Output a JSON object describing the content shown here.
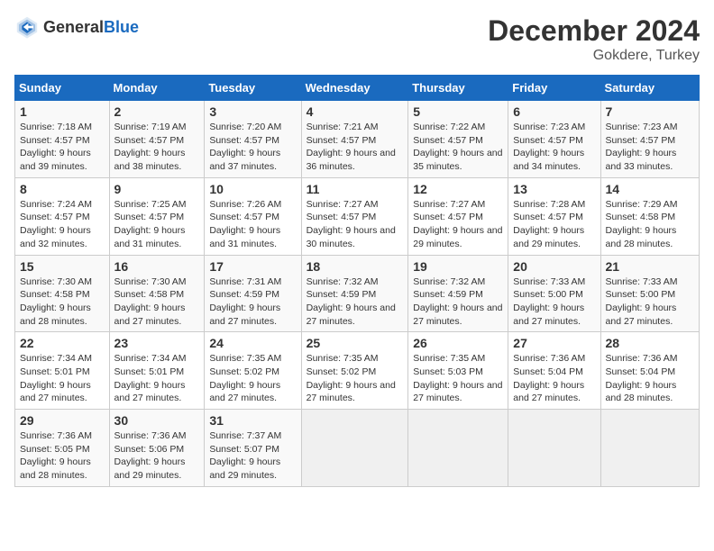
{
  "header": {
    "logo_general": "General",
    "logo_blue": "Blue",
    "title": "December 2024",
    "subtitle": "Gokdere, Turkey"
  },
  "calendar": {
    "days_of_week": [
      "Sunday",
      "Monday",
      "Tuesday",
      "Wednesday",
      "Thursday",
      "Friday",
      "Saturday"
    ],
    "weeks": [
      [
        {
          "day": "1",
          "sunrise": "7:18 AM",
          "sunset": "4:57 PM",
          "daylight": "9 hours and 39 minutes."
        },
        {
          "day": "2",
          "sunrise": "7:19 AM",
          "sunset": "4:57 PM",
          "daylight": "9 hours and 38 minutes."
        },
        {
          "day": "3",
          "sunrise": "7:20 AM",
          "sunset": "4:57 PM",
          "daylight": "9 hours and 37 minutes."
        },
        {
          "day": "4",
          "sunrise": "7:21 AM",
          "sunset": "4:57 PM",
          "daylight": "9 hours and 36 minutes."
        },
        {
          "day": "5",
          "sunrise": "7:22 AM",
          "sunset": "4:57 PM",
          "daylight": "9 hours and 35 minutes."
        },
        {
          "day": "6",
          "sunrise": "7:23 AM",
          "sunset": "4:57 PM",
          "daylight": "9 hours and 34 minutes."
        },
        {
          "day": "7",
          "sunrise": "7:23 AM",
          "sunset": "4:57 PM",
          "daylight": "9 hours and 33 minutes."
        }
      ],
      [
        {
          "day": "8",
          "sunrise": "7:24 AM",
          "sunset": "4:57 PM",
          "daylight": "9 hours and 32 minutes."
        },
        {
          "day": "9",
          "sunrise": "7:25 AM",
          "sunset": "4:57 PM",
          "daylight": "9 hours and 31 minutes."
        },
        {
          "day": "10",
          "sunrise": "7:26 AM",
          "sunset": "4:57 PM",
          "daylight": "9 hours and 31 minutes."
        },
        {
          "day": "11",
          "sunrise": "7:27 AM",
          "sunset": "4:57 PM",
          "daylight": "9 hours and 30 minutes."
        },
        {
          "day": "12",
          "sunrise": "7:27 AM",
          "sunset": "4:57 PM",
          "daylight": "9 hours and 29 minutes."
        },
        {
          "day": "13",
          "sunrise": "7:28 AM",
          "sunset": "4:57 PM",
          "daylight": "9 hours and 29 minutes."
        },
        {
          "day": "14",
          "sunrise": "7:29 AM",
          "sunset": "4:58 PM",
          "daylight": "9 hours and 28 minutes."
        }
      ],
      [
        {
          "day": "15",
          "sunrise": "7:30 AM",
          "sunset": "4:58 PM",
          "daylight": "9 hours and 28 minutes."
        },
        {
          "day": "16",
          "sunrise": "7:30 AM",
          "sunset": "4:58 PM",
          "daylight": "9 hours and 27 minutes."
        },
        {
          "day": "17",
          "sunrise": "7:31 AM",
          "sunset": "4:59 PM",
          "daylight": "9 hours and 27 minutes."
        },
        {
          "day": "18",
          "sunrise": "7:32 AM",
          "sunset": "4:59 PM",
          "daylight": "9 hours and 27 minutes."
        },
        {
          "day": "19",
          "sunrise": "7:32 AM",
          "sunset": "4:59 PM",
          "daylight": "9 hours and 27 minutes."
        },
        {
          "day": "20",
          "sunrise": "7:33 AM",
          "sunset": "5:00 PM",
          "daylight": "9 hours and 27 minutes."
        },
        {
          "day": "21",
          "sunrise": "7:33 AM",
          "sunset": "5:00 PM",
          "daylight": "9 hours and 27 minutes."
        }
      ],
      [
        {
          "day": "22",
          "sunrise": "7:34 AM",
          "sunset": "5:01 PM",
          "daylight": "9 hours and 27 minutes."
        },
        {
          "day": "23",
          "sunrise": "7:34 AM",
          "sunset": "5:01 PM",
          "daylight": "9 hours and 27 minutes."
        },
        {
          "day": "24",
          "sunrise": "7:35 AM",
          "sunset": "5:02 PM",
          "daylight": "9 hours and 27 minutes."
        },
        {
          "day": "25",
          "sunrise": "7:35 AM",
          "sunset": "5:02 PM",
          "daylight": "9 hours and 27 minutes."
        },
        {
          "day": "26",
          "sunrise": "7:35 AM",
          "sunset": "5:03 PM",
          "daylight": "9 hours and 27 minutes."
        },
        {
          "day": "27",
          "sunrise": "7:36 AM",
          "sunset": "5:04 PM",
          "daylight": "9 hours and 27 minutes."
        },
        {
          "day": "28",
          "sunrise": "7:36 AM",
          "sunset": "5:04 PM",
          "daylight": "9 hours and 28 minutes."
        }
      ],
      [
        {
          "day": "29",
          "sunrise": "7:36 AM",
          "sunset": "5:05 PM",
          "daylight": "9 hours and 28 minutes."
        },
        {
          "day": "30",
          "sunrise": "7:36 AM",
          "sunset": "5:06 PM",
          "daylight": "9 hours and 29 minutes."
        },
        {
          "day": "31",
          "sunrise": "7:37 AM",
          "sunset": "5:07 PM",
          "daylight": "9 hours and 29 minutes."
        },
        null,
        null,
        null,
        null
      ]
    ],
    "labels": {
      "sunrise": "Sunrise:",
      "sunset": "Sunset:",
      "daylight": "Daylight:"
    }
  }
}
